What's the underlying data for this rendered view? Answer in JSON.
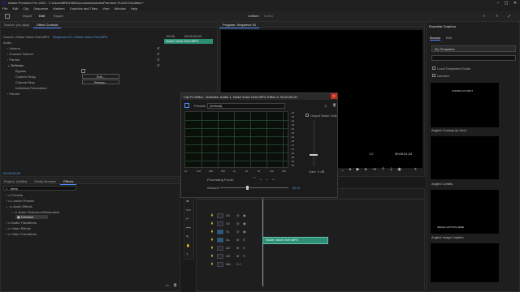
{
  "app": {
    "title": "Adobe Premiere Pro 2023 - C:\\Users\\BRAHIM\\Documents\\Adobe\\Premiere Pro\\23.0\\Untitled *"
  },
  "menu": [
    "File",
    "Edit",
    "Clip",
    "Sequence",
    "Markers",
    "Graphics and Titles",
    "View",
    "Window",
    "Help"
  ],
  "workspace": {
    "tabs": [
      "Import",
      "Edit",
      "Export"
    ],
    "active_tab": "Edit",
    "project_title": "Untitled",
    "project_sub": "Edited"
  },
  "source_panel": {
    "tabs": [
      "Source: (no clips)",
      "Effect Controls"
    ],
    "header": "Source • Noise Voice Over.MP3",
    "seq_link": "Sequence 01 • Noise Voice Over.MP3",
    "section_audio": "Audio",
    "rows": [
      "Volume",
      "Channel Volume",
      "Panner",
      "DeNoise"
    ],
    "denoise_items": [
      "Bypass",
      "Custom Setup",
      "Channel Map",
      "Individual Parameters"
    ],
    "edit_label": "Edit...",
    "remap_label": "Remap...",
    "after_row": "Panner",
    "clip_label": "Noise Voice Over.MP3",
    "tc_start": "00:00",
    "tc_end": "00:00:05:00",
    "timecode": "00:00:00:00"
  },
  "program": {
    "title": "Program: Sequence 01",
    "fraction": "1/2",
    "timecode": "00;00;01;24"
  },
  "project_panel": {
    "tabs": [
      "Project: Untitled",
      "Media Browser",
      "Effects"
    ],
    "search_value": "deno",
    "tree": [
      "Presets",
      "Lumetri Presets",
      "Audio Effects",
      "Noise Reduction/Restoration",
      "DeNoise",
      "Audio Transitions",
      "Video Effects",
      "Video Transitions"
    ]
  },
  "clipfx": {
    "title": "Clip Fx Editor - DeNoise: Audio 1, Noise Voice Over.MP3, Effect 3, 00;00;00;00",
    "presets_label": "Presets:",
    "preset_value": "(Default)",
    "output_noise": "Output Noise Only",
    "processing_focus": "Processing Focus:",
    "amount_label": "Amount:",
    "amount_value": "40 %",
    "gain_label": "Gain:",
    "gain_value": "0 dB",
    "db_ticks": [
      "-30",
      "-35",
      "-40",
      "-45",
      "-50",
      "-55",
      "-60",
      "-65",
      "-70",
      "-75",
      "-80",
      "-85",
      "-90",
      "-95"
    ],
    "hz_ticks": [
      "Hz",
      "100",
      "200",
      "500",
      "1k",
      "2k",
      "5k",
      "10k",
      "20k"
    ]
  },
  "timeline": {
    "sequence_tab": "Sequence 01",
    "timecode": "00;00;01;24",
    "tracks": [
      "V3",
      "V2",
      "V1",
      "A1",
      "A2",
      "A3",
      "Mix"
    ],
    "mix_value": "0.0",
    "clip_name": "Noise Voice Over.MP3"
  },
  "essential_graphics": {
    "title": "Essential Graphics",
    "tabs": [
      "Browse",
      "Edit"
    ],
    "dropdown": "My Templates",
    "checks": [
      "Local Templates Folder",
      "Libraries"
    ],
    "templates": [
      "Angled Coming Up Next",
      "Angled Credits",
      "Angled Image Caption"
    ],
    "thumb_texts": [
      "COMING UP NEXT",
      "IMAGE CAPTION HERE"
    ]
  },
  "colors": {
    "accent": "#4b8cff",
    "clip_green": "#2f8f76",
    "close_red": "#c42b1c",
    "clip_label_green": "#1f8a5f"
  }
}
